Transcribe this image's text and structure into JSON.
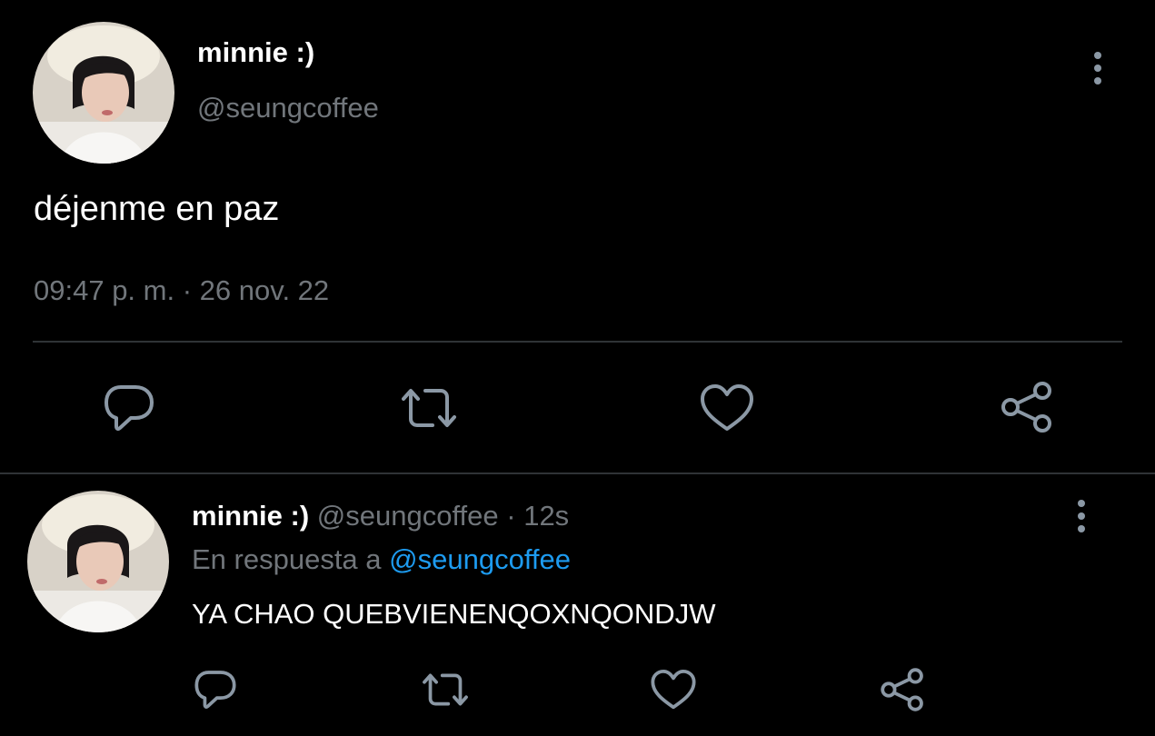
{
  "main_tweet": {
    "name": "minnie :)",
    "handle": "@seungcoffee",
    "text": "déjenme en paz",
    "time": "09:47 p. m.",
    "separator": "·",
    "date": "26 nov. 22",
    "actions": [
      "reply-icon",
      "retweet-icon",
      "like-icon",
      "share-icon"
    ]
  },
  "reply_tweet": {
    "name": "minnie :)",
    "handle": "@seungcoffee",
    "separator": "·",
    "time": "12s",
    "in_reply_prefix": "En respuesta a",
    "in_reply_handle": "@seungcoffee",
    "text": "YA CHAO QUEBVIENENQOXNQONDJW",
    "actions": [
      "reply-icon",
      "retweet-icon",
      "like-icon",
      "share-icon"
    ]
  },
  "colors": {
    "background": "#000000",
    "primary_text": "#ffffff",
    "secondary_text": "#71767b",
    "link": "#1d9bf0",
    "divider": "#2f3336",
    "icon": "#8b98a5"
  }
}
